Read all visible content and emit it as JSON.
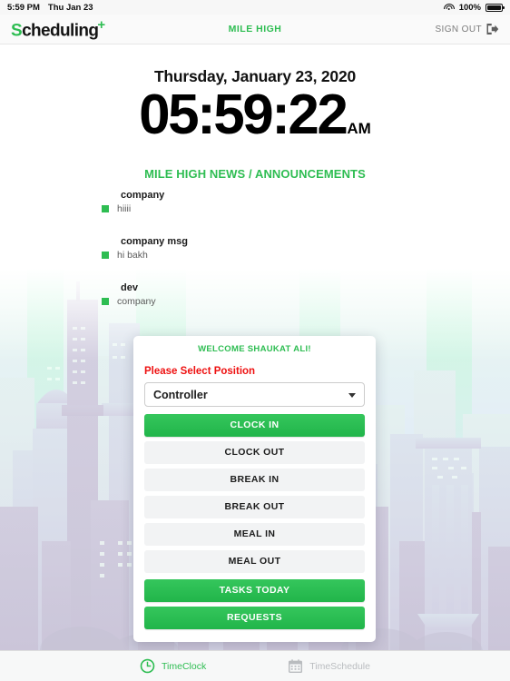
{
  "statusbar": {
    "time": "5:59 PM",
    "date": "Thu Jan 23",
    "wifi_icon": "wifi-icon",
    "battery_percent": "100%",
    "battery_icon": "battery-full-icon"
  },
  "header": {
    "logo_first_letter": "S",
    "logo_rest": "cheduling",
    "logo_plus": "+",
    "company": "MILE HIGH",
    "sign_out_label": "SIGN OUT",
    "sign_out_icon": "sign-out-icon"
  },
  "main": {
    "date_line": "Thursday, January 23, 2020",
    "clock_time": "05:59:22",
    "clock_meridiem": "AM",
    "news_heading": "MILE HIGH NEWS / ANNOUNCEMENTS",
    "announcements": [
      {
        "title": "company",
        "body": "hiiii"
      },
      {
        "title": "company msg",
        "body": "hi bakh"
      },
      {
        "title": "dev",
        "body": "company"
      }
    ]
  },
  "card": {
    "welcome": "WELCOME SHAUKAT ALI!",
    "select_label": "Please Select Position",
    "position_selected": "Controller",
    "caret_icon": "chevron-down-icon",
    "actions": [
      {
        "label": "CLOCK IN",
        "style": "green"
      },
      {
        "label": "CLOCK OUT",
        "style": "grey"
      },
      {
        "label": "BREAK IN",
        "style": "grey"
      },
      {
        "label": "BREAK OUT",
        "style": "grey"
      },
      {
        "label": "MEAL IN",
        "style": "grey"
      },
      {
        "label": "MEAL OUT",
        "style": "grey"
      },
      {
        "label": "TASKS TODAY",
        "style": "green"
      },
      {
        "label": "REQUESTS",
        "style": "green"
      }
    ]
  },
  "tabbar": {
    "tabs": [
      {
        "label": "TimeClock",
        "icon": "clock-icon",
        "active": true
      },
      {
        "label": "TimeSchedule",
        "icon": "calendar-icon",
        "active": false
      }
    ]
  },
  "colors": {
    "brand_green": "#2ebd52",
    "button_green": "#21b54a",
    "alert_red": "#ee1111",
    "grey_button": "#f2f3f4",
    "inactive_grey": "#b9bcbf"
  }
}
